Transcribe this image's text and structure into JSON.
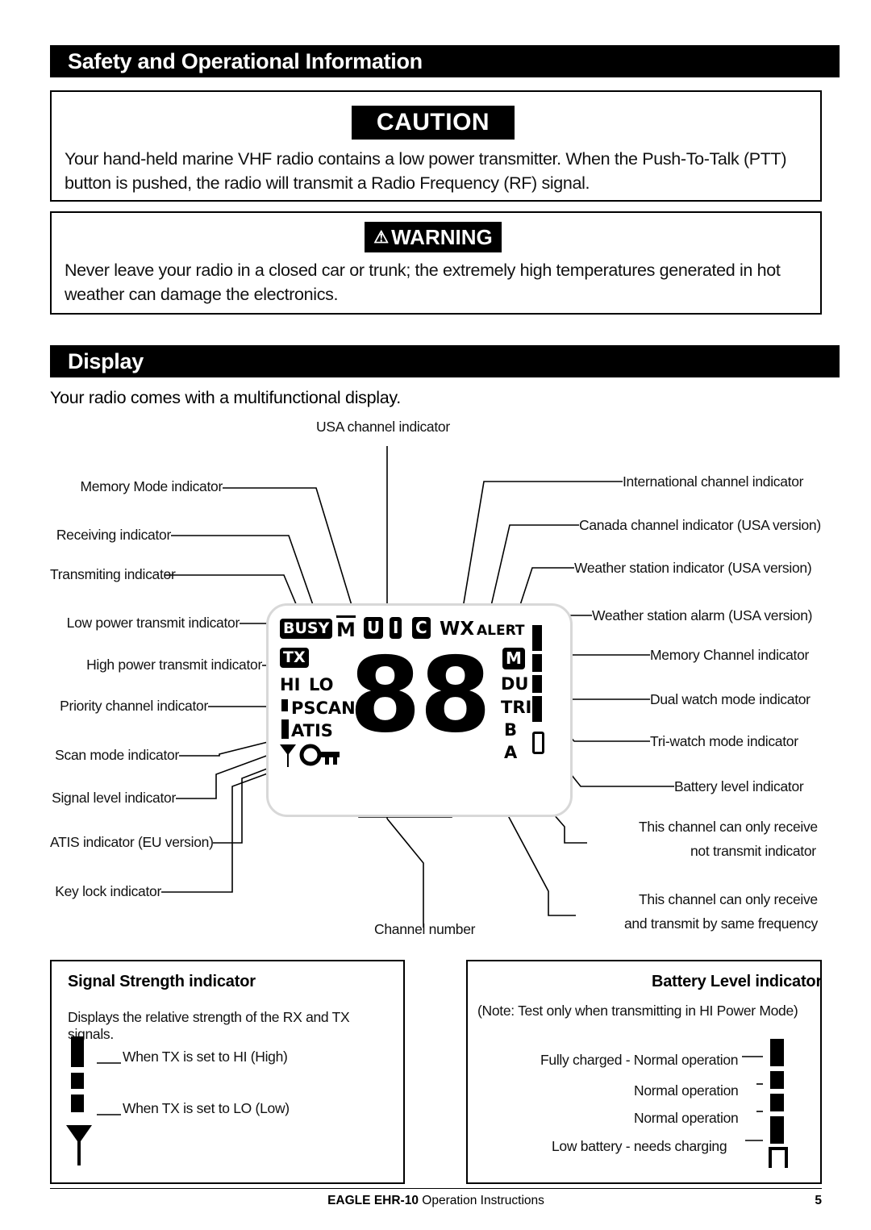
{
  "sections": {
    "safety_title": "Safety and Operational Information",
    "display_title": "Display"
  },
  "caution": {
    "label": "CAUTION",
    "text": "Your hand-held marine VHF radio contains a low power transmitter. When the Push-To-Talk (PTT) button is pushed, the radio will transmit a Radio Frequency (RF) signal."
  },
  "warning": {
    "label": "WARNING",
    "icon": "warning-triangle-icon",
    "text": "Never leave your radio in a closed car or trunk; the extremely high temperatures generated in hot weather can damage the electronics."
  },
  "display": {
    "intro": "Your radio comes with a multifunctional display.",
    "labels_left": [
      "Memory Mode indicator",
      "Receiving indicator",
      "Transmiting indicator",
      "Low power transmit indicator",
      "High power transmit indicator",
      "Priority channel indicator",
      "Scan mode indicator",
      "Signal level indicator",
      "ATIS indicator (EU version)",
      "Key lock indicator"
    ],
    "labels_right": [
      "International channel indicator",
      "Canada channel indicator (USA version)",
      "Weather station indicator (USA version)",
      "Weather station alarm (USA version)",
      "Memory Channel indicator",
      "Dual watch mode indicator",
      "Tri-watch mode indicator",
      "Battery level indicator"
    ],
    "label_top": "USA channel indicator",
    "label_bottom_center": "Channel number",
    "label_rx_only_1": "This channel can only receive",
    "label_rx_only_2": "not transmit indicator",
    "label_same_freq_1": "This channel can only receive",
    "label_same_freq_2": "and transmit by same frequency",
    "lcd": {
      "busy": "BUSY",
      "m_icon": "M",
      "u": "U",
      "i": "I",
      "c": "C",
      "wx": "WX",
      "alert": "ALERT",
      "tx": "TX",
      "hi": "HI",
      "lo": "LO",
      "pscan": "PSCAN",
      "atis": "ATIS",
      "channel": "88",
      "mem": "M",
      "du": "DU",
      "tri": "TRI",
      "b": "B",
      "a": "A"
    }
  },
  "signal_box": {
    "title": "Signal Strength indicator",
    "text": "Displays the relative strength of the RX and TX signals.",
    "hi_label": "When TX is set to HI  (High)",
    "lo_label": "When TX is set to LO  (Low)"
  },
  "battery_box": {
    "title": "Battery Level indicator",
    "note": "(Note: Test only when transmitting in HI Power Mode)",
    "rows": [
      "Fully charged - Normal operation",
      "Normal operation",
      "Normal operation",
      "Low battery - needs charging"
    ]
  },
  "footer": {
    "brand": "EAGLE",
    "model": "EHR-10",
    "doc": "Operation Instructions",
    "page": "5"
  }
}
